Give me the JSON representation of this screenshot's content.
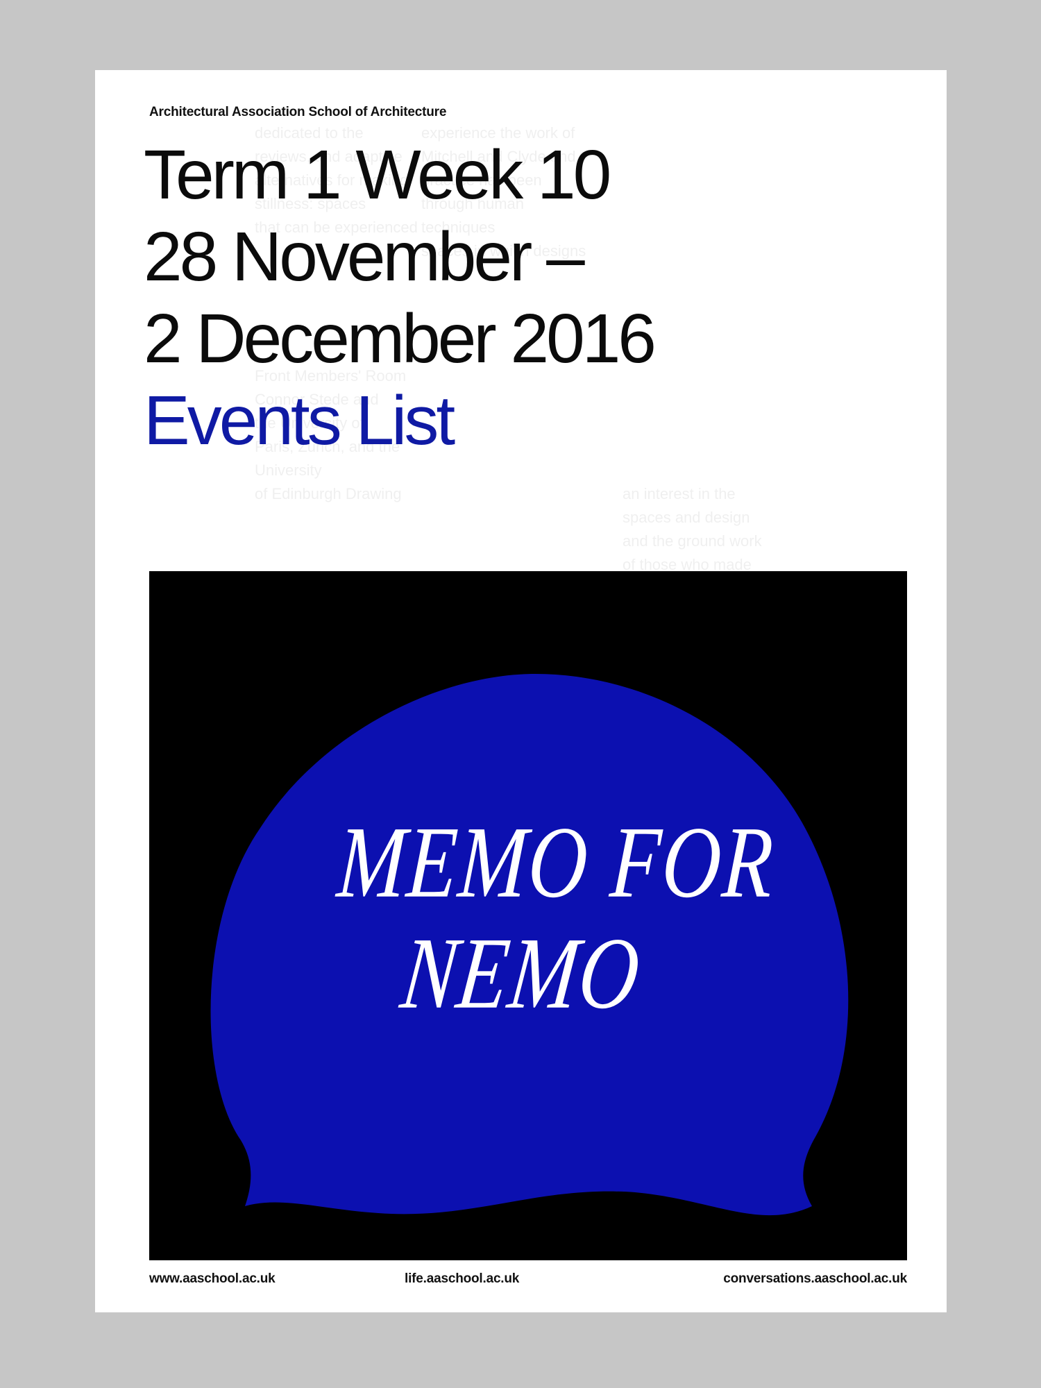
{
  "header": {
    "school_name": "Architectural Association School of Architecture"
  },
  "headline": {
    "line1": "Term 1 Week 10",
    "line2": "28 November –",
    "line3": "2 December 2016",
    "line4": "Events List"
  },
  "cover": {
    "title_line1": "MEMO FOR",
    "title_line2": "NEMO"
  },
  "footer": {
    "link_left": "www.aaschool.ac.uk",
    "link_center": "life.aaschool.ac.uk",
    "link_right": "conversations.aaschool.ac.uk"
  },
  "colors": {
    "page_background": "#c6c6c6",
    "sheet": "#ffffff",
    "text": "#0b0b0b",
    "accent_blue": "#0f1aa4",
    "cap_blue": "#0c10b0",
    "image_background": "#000000"
  }
}
